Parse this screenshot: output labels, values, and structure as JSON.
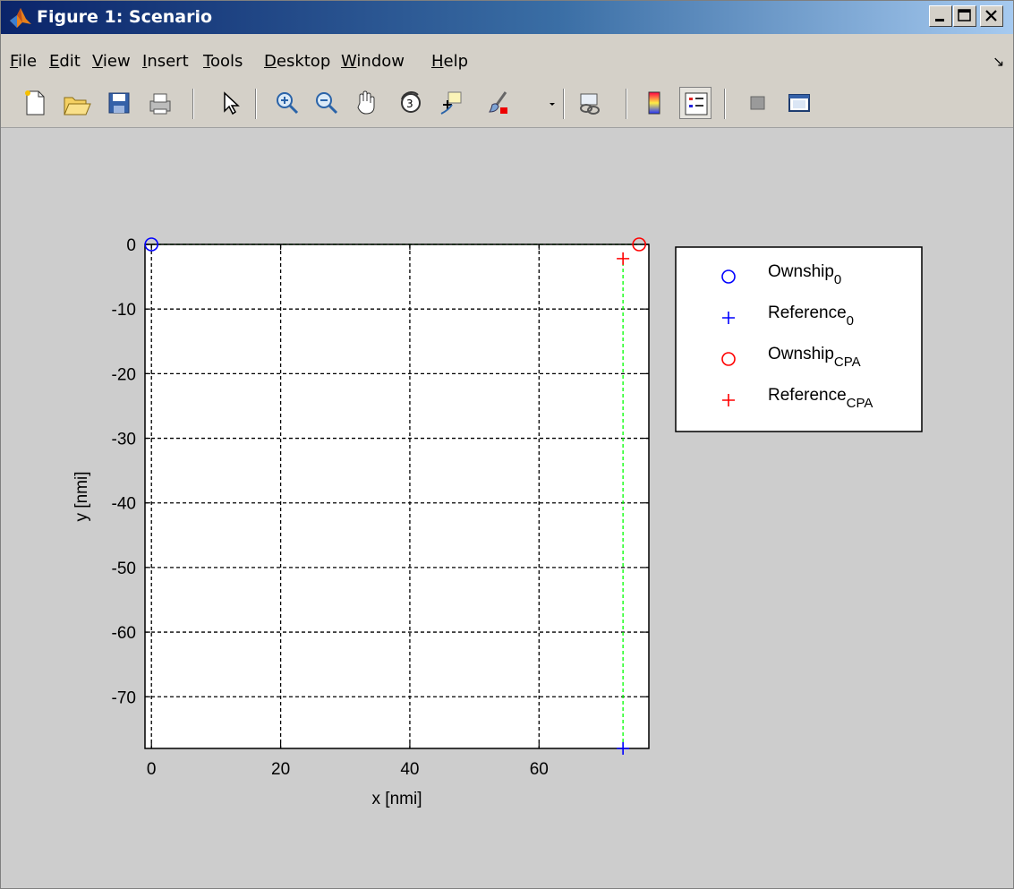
{
  "window": {
    "title": "Figure 1: Scenario"
  },
  "menu": {
    "items": [
      {
        "label": "File",
        "ul": "F",
        "rest": "ile"
      },
      {
        "label": "Edit",
        "ul": "E",
        "rest": "dit"
      },
      {
        "label": "View",
        "ul": "V",
        "rest": "iew"
      },
      {
        "label": "Insert",
        "ul": "I",
        "rest": "nsert"
      },
      {
        "label": "Tools",
        "ul": "T",
        "rest": "ools"
      },
      {
        "label": "Desktop",
        "ul": "D",
        "rest": "esktop"
      },
      {
        "label": "Window",
        "ul": "W",
        "rest": "indow"
      },
      {
        "label": "Help",
        "ul": "H",
        "rest": "elp"
      }
    ]
  },
  "toolbar": {
    "buttons": [
      "new-figure-icon",
      "open-file-icon",
      "save-icon",
      "print-icon",
      "edit-plot-icon",
      "zoom-in-icon",
      "zoom-out-icon",
      "pan-hand-icon",
      "rotate-3d-icon",
      "data-cursor-icon",
      "brush-icon",
      "link-plot-icon",
      "colorbar-icon",
      "legend-icon",
      "hide-plot-tools-icon",
      "show-plot-tools-icon"
    ]
  },
  "chart_data": {
    "type": "scatter",
    "title": "",
    "xlabel": "x [nmi]",
    "ylabel": "y [nmi]",
    "xlim": [
      -1,
      77
    ],
    "ylim": [
      -78,
      0
    ],
    "xticks": [
      0,
      20,
      40,
      60
    ],
    "yticks": [
      0,
      -10,
      -20,
      -30,
      -40,
      -50,
      -60,
      -70
    ],
    "grid": true,
    "series": [
      {
        "name": "Ownship_0",
        "base": "Ownship",
        "sub": "0",
        "marker": "o",
        "color": "#0000ff",
        "x": [
          0
        ],
        "y": [
          0
        ]
      },
      {
        "name": "Reference_0",
        "base": "Reference",
        "sub": "0",
        "marker": "+",
        "color": "#0000ff",
        "x": [
          73
        ],
        "y": [
          -78
        ]
      },
      {
        "name": "Ownship_CPA",
        "base": "Ownship",
        "sub": "CPA",
        "marker": "o",
        "color": "#ff0000",
        "x": [
          75.5
        ],
        "y": [
          0
        ]
      },
      {
        "name": "Reference_CPA",
        "base": "Reference",
        "sub": "CPA",
        "marker": "+",
        "color": "#ff0000",
        "x": [
          73
        ],
        "y": [
          -2.2
        ]
      }
    ],
    "lines": [
      {
        "color": "#00ff00",
        "style": "dashed",
        "x": [
          0,
          75.5
        ],
        "y": [
          0,
          0
        ]
      },
      {
        "color": "#00ff00",
        "style": "dashed",
        "x": [
          73,
          73
        ],
        "y": [
          -78,
          -2.2
        ]
      }
    ],
    "legend": "right of plot"
  }
}
